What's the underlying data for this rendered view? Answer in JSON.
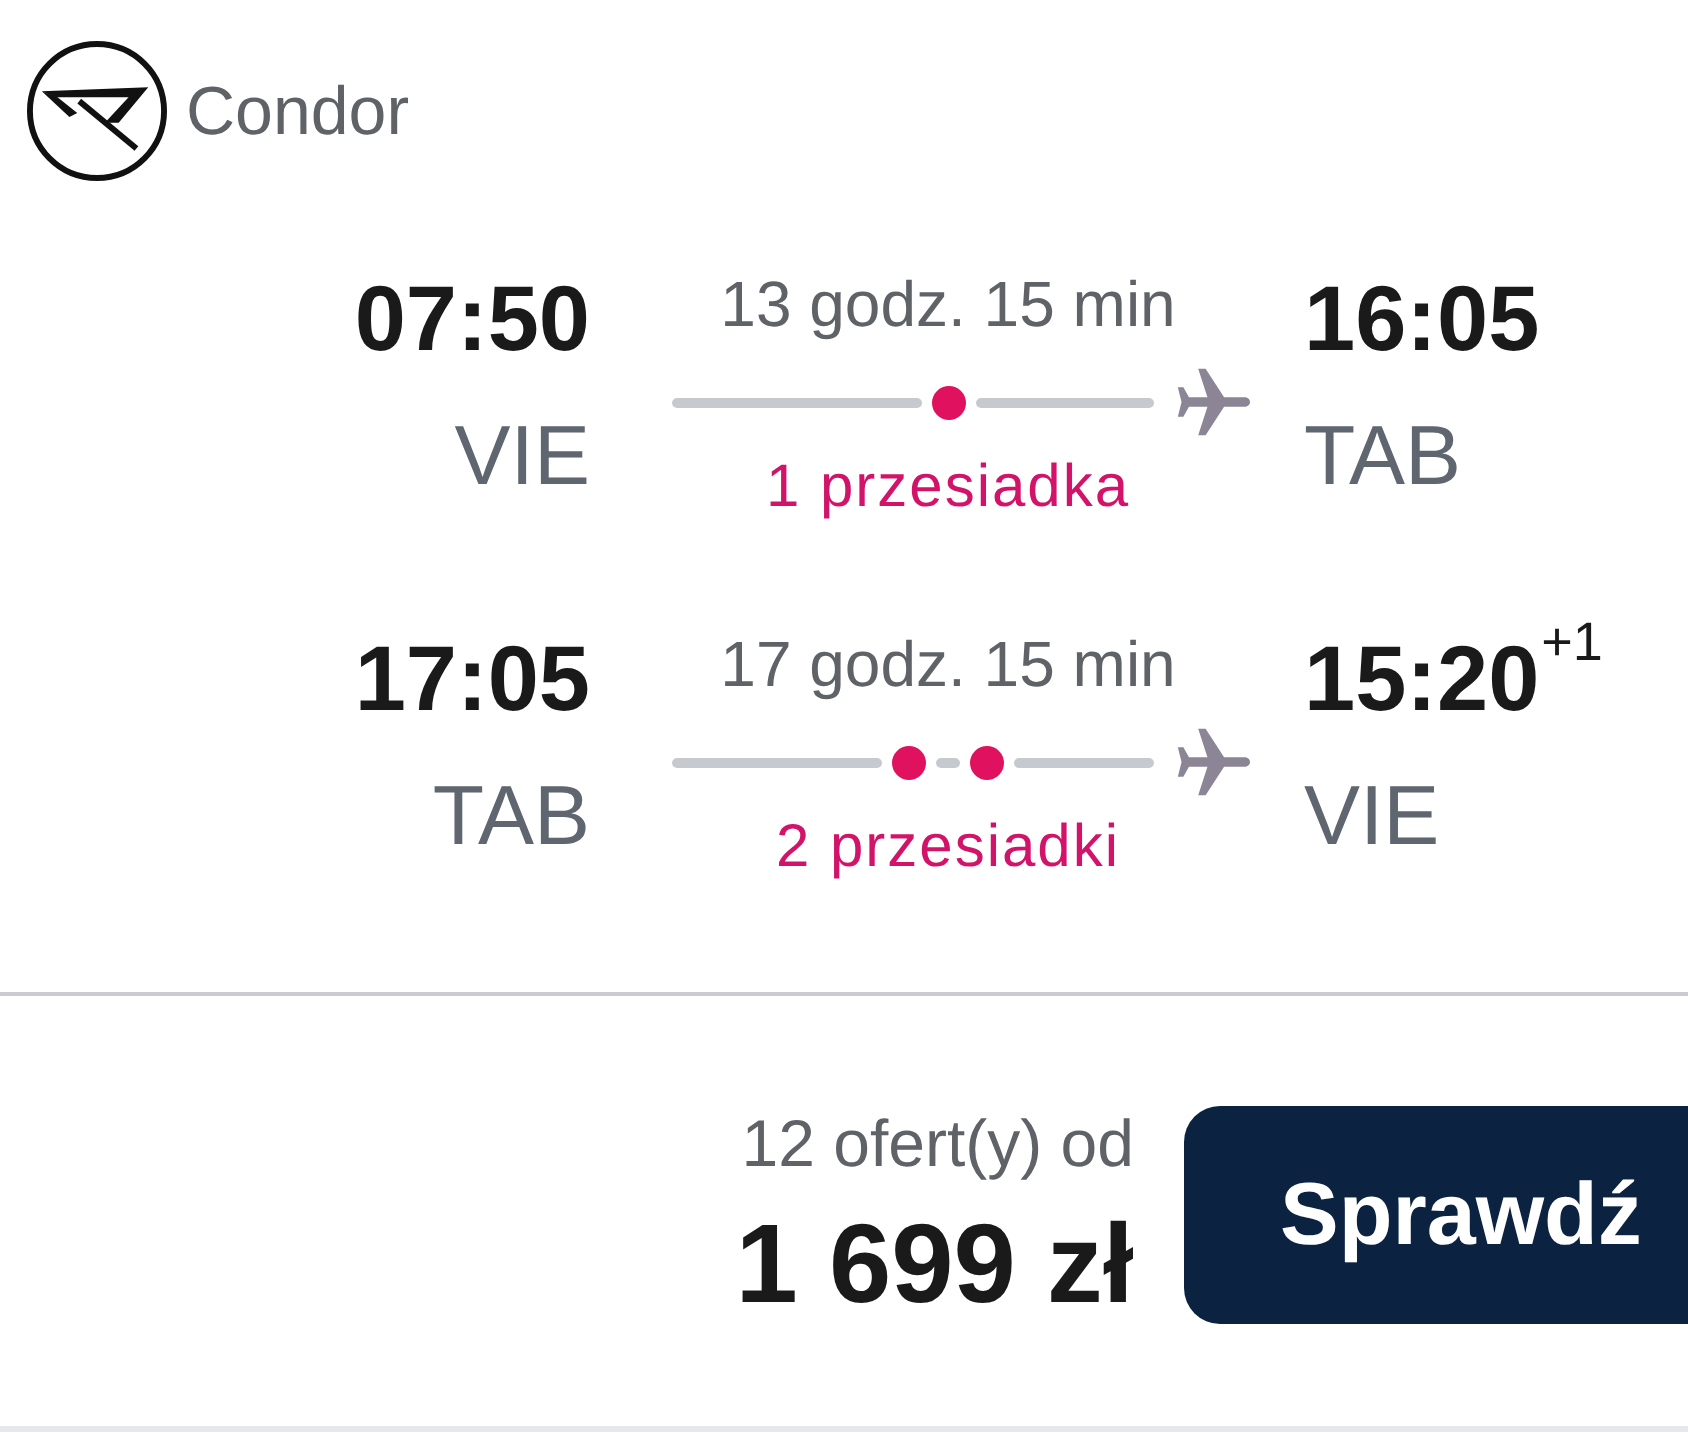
{
  "airline": {
    "name": "Condor"
  },
  "legs": [
    {
      "departure": {
        "time": "07:50",
        "airport": "VIE"
      },
      "duration": "13 godz. 15 min",
      "stops": [
        {
          "kind": "layover"
        }
      ],
      "stops_label": "1 przesiadka",
      "arrival": {
        "time": "16:05",
        "airport": "TAB"
      }
    },
    {
      "departure": {
        "time": "17:05",
        "airport": "TAB"
      },
      "duration": "17 godz. 15 min",
      "stops": [
        {
          "kind": "layover"
        },
        {
          "kind": "layover"
        }
      ],
      "stops_label": "2 przesiadki",
      "arrival": {
        "time": "15:20",
        "day_offset": "+1",
        "airport": "VIE"
      }
    }
  ],
  "offer": {
    "count_label": "12 ofert(y) od",
    "price": "1 699 zł",
    "button": {
      "label": "Sprawdź"
    }
  }
}
